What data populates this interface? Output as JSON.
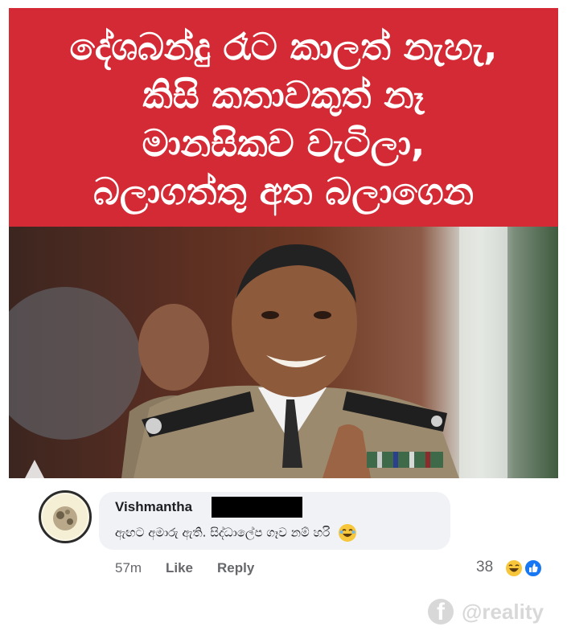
{
  "post": {
    "caption_lines": [
      "දේශබන්දු රෑට කාලත් නැහැ,",
      "කිසි කතාවකුත් නෑ",
      "මානසිකව වැටිලා,",
      "බලාගත්තු අත බලාගෙන"
    ],
    "caption_bg_color": "#d42a35"
  },
  "comment": {
    "author": "Vishmantha",
    "text": "ඇඟට අමාරු ඇති. සිද්ධාලේප ගෑව නම් හරි",
    "time": "57m",
    "like_label": "Like",
    "reply_label": "Reply",
    "reaction_count": "38",
    "reactions": [
      "haha-icon",
      "like-icon"
    ]
  },
  "watermark": {
    "icon": "facebook-icon",
    "text": "@reality"
  }
}
